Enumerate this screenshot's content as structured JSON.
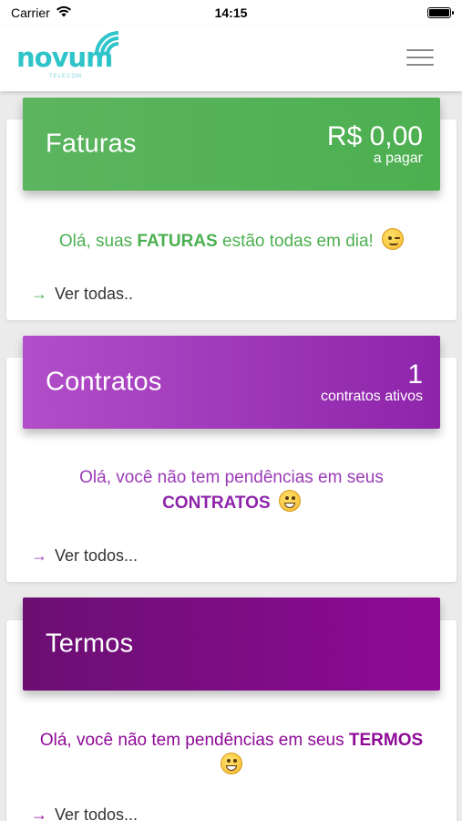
{
  "status_bar": {
    "carrier": "Carrier",
    "time": "14:15"
  },
  "header": {
    "logo_text": "novum",
    "logo_sub": "TELECOM"
  },
  "cards": [
    {
      "title": "Faturas",
      "value": "R$ 0,00",
      "value_sub": "a pagar",
      "msg_before": "Olá, suas ",
      "msg_bold": "FATURAS",
      "msg_after": " estão todas em dia!",
      "link": "Ver todas..",
      "color": "#4caf50"
    },
    {
      "title": "Contratos",
      "value": "1",
      "value_sub": "contratos ativos",
      "msg_line1": "Olá, você não tem pendências em seus",
      "msg_bold": "CONTRATOS",
      "link": "Ver todos...",
      "color": "#9c3bb7"
    },
    {
      "title": "Termos",
      "msg_before": "Olá, você não tem pendências em seus ",
      "msg_bold": "TERMOS",
      "link": "Ver todos...",
      "color": "#8e0a96"
    }
  ],
  "icons": {
    "menu": "hamburger-menu-icon",
    "arrow": "arrow-right-icon",
    "wifi": "wifi-icon",
    "battery": "battery-icon",
    "emoji_wink": "winking-face-icon",
    "emoji_grin": "grinning-face-icon"
  }
}
